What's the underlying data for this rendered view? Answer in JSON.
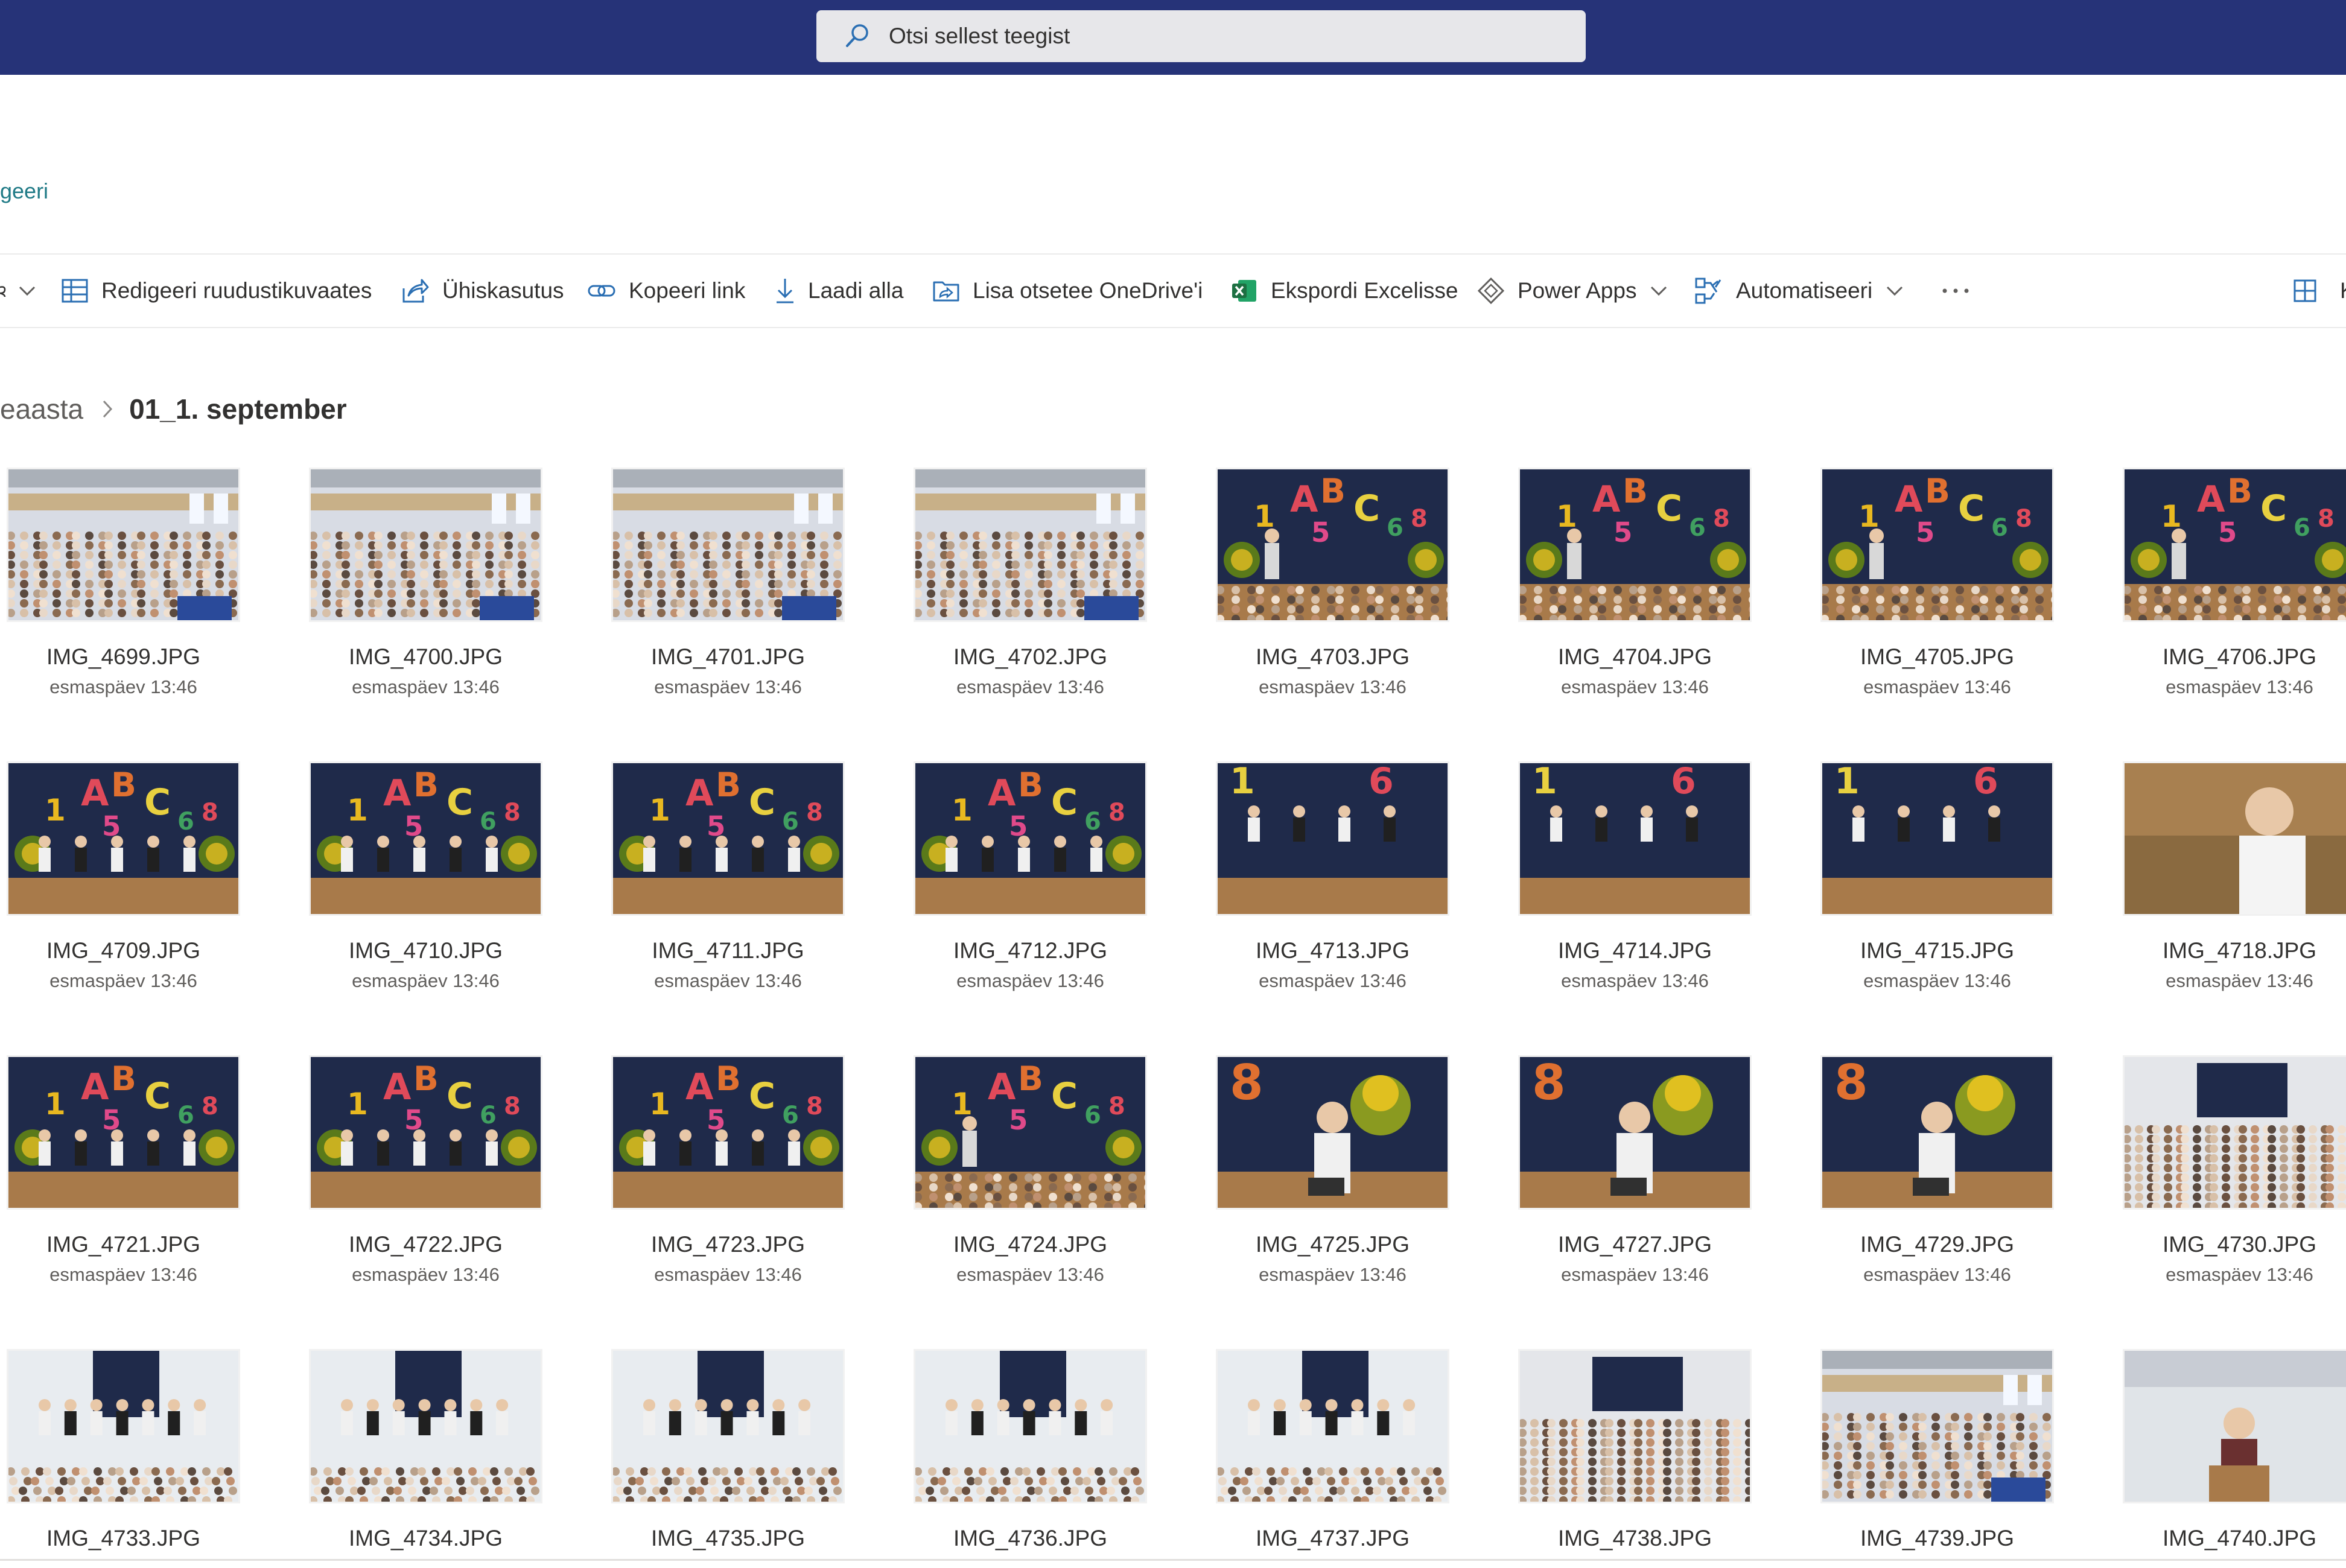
{
  "search": {
    "placeholder": "Otsi sellest teegist"
  },
  "header": {
    "edit_link": "geeri"
  },
  "commandbar": {
    "items": [
      {
        "label": "Redigeeri ruudustikuvaates",
        "icon": "grid-edit-icon"
      },
      {
        "label": "Ühiskasutus",
        "icon": "share-icon"
      },
      {
        "label": "Kopeeri link",
        "icon": "link-icon"
      },
      {
        "label": "Laadi alla",
        "icon": "download-icon"
      },
      {
        "label": "Lisa otsetee OneDrive'i",
        "icon": "onedrive-shortcut-icon"
      },
      {
        "label": "Ekspordi Excelisse",
        "icon": "excel-icon"
      },
      {
        "label": "Power Apps",
        "icon": "power-apps-icon"
      },
      {
        "label": "Automatiseeri",
        "icon": "automate-icon"
      },
      {
        "label": "K",
        "icon": "view-grid-icon"
      }
    ]
  },
  "breadcrumb": {
    "previous": "eaasta",
    "current": "01_1. september"
  },
  "colors": {
    "suite_bar": "#263378",
    "search_bg": "#e7e7ea",
    "link": "#1f7a86",
    "excel_green": "#1d6f42"
  },
  "files": [
    {
      "name": "IMG_4699.JPG",
      "date": "esmaspäev 13:46",
      "scene": "hall"
    },
    {
      "name": "IMG_4700.JPG",
      "date": "esmaspäev 13:46",
      "scene": "hall"
    },
    {
      "name": "IMG_4701.JPG",
      "date": "esmaspäev 13:46",
      "scene": "hall"
    },
    {
      "name": "IMG_4702.JPG",
      "date": "esmaspäev 13:46",
      "scene": "hall"
    },
    {
      "name": "IMG_4703.JPG",
      "date": "esmaspäev 13:46",
      "scene": "stage"
    },
    {
      "name": "IMG_4704.JPG",
      "date": "esmaspäev 13:46",
      "scene": "stage"
    },
    {
      "name": "IMG_4705.JPG",
      "date": "esmaspäev 13:46",
      "scene": "stage"
    },
    {
      "name": "IMG_4706.JPG",
      "date": "esmaspäev 13:46",
      "scene": "stage"
    },
    {
      "name": "IMG_4709.JPG",
      "date": "esmaspäev 13:46",
      "scene": "kids"
    },
    {
      "name": "IMG_4710.JPG",
      "date": "esmaspäev 13:46",
      "scene": "kids"
    },
    {
      "name": "IMG_4711.JPG",
      "date": "esmaspäev 13:46",
      "scene": "kids"
    },
    {
      "name": "IMG_4712.JPG",
      "date": "esmaspäev 13:46",
      "scene": "kids"
    },
    {
      "name": "IMG_4713.JPG",
      "date": "esmaspäev 13:46",
      "scene": "kidsclose"
    },
    {
      "name": "IMG_4714.JPG",
      "date": "esmaspäev 13:46",
      "scene": "kidsclose"
    },
    {
      "name": "IMG_4715.JPG",
      "date": "esmaspäev 13:46",
      "scene": "kidsclose"
    },
    {
      "name": "IMG_4718.JPG",
      "date": "esmaspäev 13:46",
      "scene": "speaker"
    },
    {
      "name": "IMG_4721.JPG",
      "date": "esmaspäev 13:46",
      "scene": "kids"
    },
    {
      "name": "IMG_4722.JPG",
      "date": "esmaspäev 13:46",
      "scene": "kids"
    },
    {
      "name": "IMG_4723.JPG",
      "date": "esmaspäev 13:46",
      "scene": "kids"
    },
    {
      "name": "IMG_4724.JPG",
      "date": "esmaspäev 13:46",
      "scene": "stage"
    },
    {
      "name": "IMG_4725.JPG",
      "date": "esmaspäev 13:46",
      "scene": "woman"
    },
    {
      "name": "IMG_4727.JPG",
      "date": "esmaspäev 13:46",
      "scene": "woman"
    },
    {
      "name": "IMG_4729.JPG",
      "date": "esmaspäev 13:46",
      "scene": "woman"
    },
    {
      "name": "IMG_4730.JPG",
      "date": "esmaspäev 13:46",
      "scene": "hallwide"
    },
    {
      "name": "IMG_4733.JPG",
      "date": "",
      "scene": "choir"
    },
    {
      "name": "IMG_4734.JPG",
      "date": "",
      "scene": "choir"
    },
    {
      "name": "IMG_4735.JPG",
      "date": "",
      "scene": "choir"
    },
    {
      "name": "IMG_4736.JPG",
      "date": "",
      "scene": "choir"
    },
    {
      "name": "IMG_4737.JPG",
      "date": "",
      "scene": "choir"
    },
    {
      "name": "IMG_4738.JPG",
      "date": "",
      "scene": "hallwide"
    },
    {
      "name": "IMG_4739.JPG",
      "date": "",
      "scene": "hall"
    },
    {
      "name": "IMG_4740.JPG",
      "date": "",
      "scene": "podium"
    }
  ]
}
